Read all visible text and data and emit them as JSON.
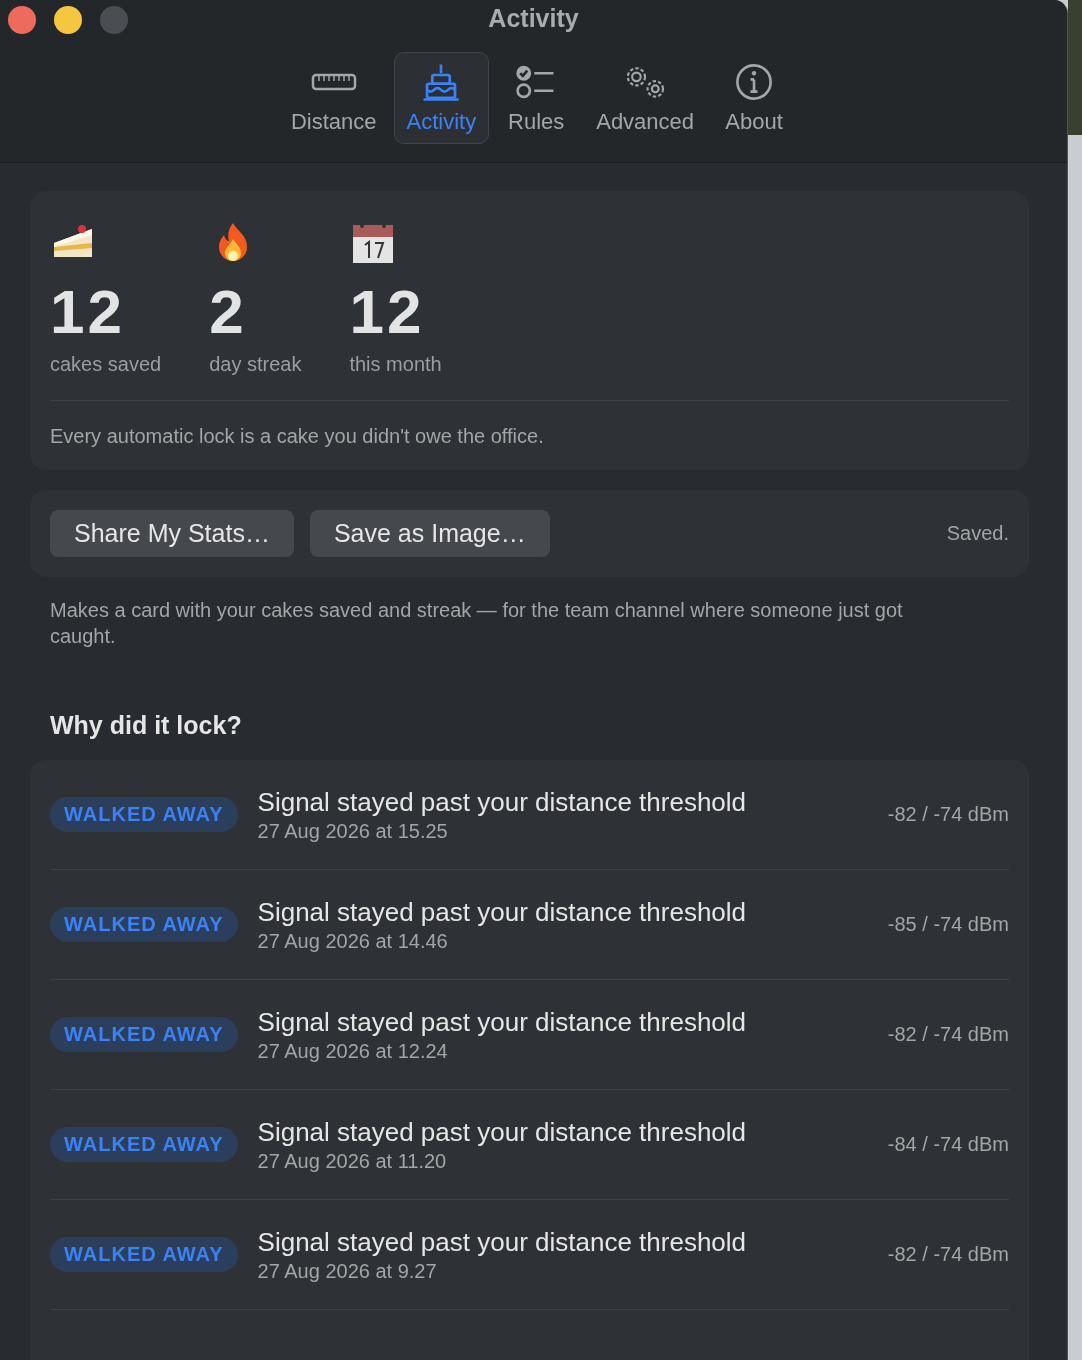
{
  "window": {
    "title": "Activity"
  },
  "tabs": [
    {
      "kind": "ruler",
      "label": "Distance",
      "selected": false
    },
    {
      "kind": "cake",
      "label": "Activity",
      "selected": true
    },
    {
      "kind": "checklist",
      "label": "Rules",
      "selected": false
    },
    {
      "kind": "gears",
      "label": "Advanced",
      "selected": false
    },
    {
      "kind": "info",
      "label": "About",
      "selected": false
    }
  ],
  "stats": [
    {
      "kind": "cake",
      "value": "12",
      "label": "cakes saved"
    },
    {
      "kind": "flame",
      "value": "2",
      "label": "day streak"
    },
    {
      "kind": "calendar",
      "value": "12",
      "label": "this month"
    }
  ],
  "stats_note": "Every automatic lock is a cake you didn't owe the office.",
  "share": {
    "buttons": [
      "Share My Stats…",
      "Save as Image…"
    ],
    "status": "Saved.",
    "description": "Makes a card with your cakes saved and streak — for the team channel where someone just got caught."
  },
  "locks": {
    "heading": "Why did it lock?",
    "rows": [
      {
        "badge": "WALKED AWAY",
        "title": "Signal stayed past your distance threshold",
        "time": "27 Aug 2026 at 15.25",
        "reading": "-82 / -74 dBm"
      },
      {
        "badge": "WALKED AWAY",
        "title": "Signal stayed past your distance threshold",
        "time": "27 Aug 2026 at 14.46",
        "reading": "-85 / -74 dBm"
      },
      {
        "badge": "WALKED AWAY",
        "title": "Signal stayed past your distance threshold",
        "time": "27 Aug 2026 at 12.24",
        "reading": "-82 / -74 dBm"
      },
      {
        "badge": "WALKED AWAY",
        "title": "Signal stayed past your distance threshold",
        "time": "27 Aug 2026 at 11.20",
        "reading": "-84 / -74 dBm"
      },
      {
        "badge": "WALKED AWAY",
        "title": "Signal stayed past your distance threshold",
        "time": "27 Aug 2026 at 9.27",
        "reading": "-82 / -74 dBm"
      }
    ]
  }
}
